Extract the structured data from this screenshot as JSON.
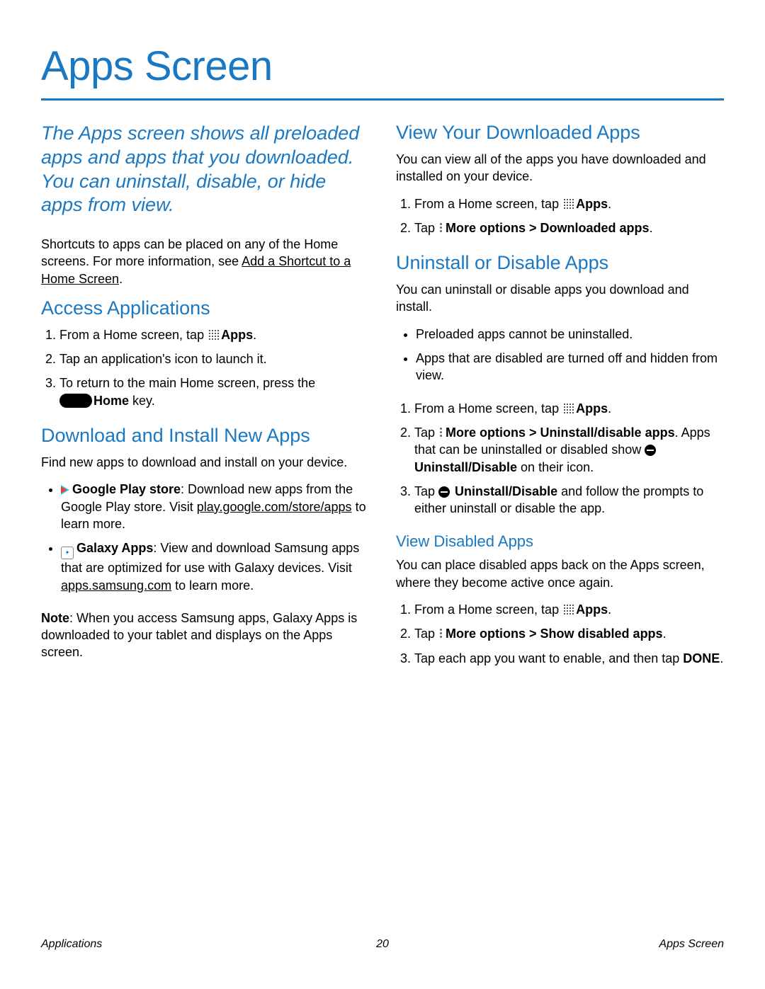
{
  "title": "Apps Screen",
  "intro": "The Apps screen shows all preloaded apps and apps that you downloaded. You can uninstall, disable, or hide apps from view.",
  "shortcuts_p1": "Shortcuts to apps can be placed on any of the Home screens. For more information, see ",
  "shortcuts_link": "Add a Shortcut to a Home Screen",
  "shortcuts_p2": ".",
  "access": {
    "heading": "Access Applications",
    "step1a": "From a Home screen, tap ",
    "step1b": "Apps",
    "step1c": ".",
    "step2": "Tap an application's icon to launch it.",
    "step3a": "To return to the main Home screen, press the ",
    "step3b": "Home",
    "step3c": " key."
  },
  "download": {
    "heading": "Download and Install New Apps",
    "intro": "Find new apps to download and install on your device.",
    "play_b": "Google Play store",
    "play_txt": ": Download new apps from the Google Play store. Visit ",
    "play_link": "play.google.com/store/apps",
    "play_end": " to learn more.",
    "galaxy_b": "Galaxy Apps",
    "galaxy_txt": ": View and download Samsung apps that are optimized for use with Galaxy devices. Visit ",
    "galaxy_link": "apps.samsung.com",
    "galaxy_end": " to learn more.",
    "note_b": "Note",
    "note_txt": ": When you access Samsung apps, Galaxy Apps is downloaded to your tablet and displays on the Apps screen."
  },
  "view_dl": {
    "heading": "View Your Downloaded Apps",
    "intro": "You can view all of the apps you have downloaded and installed on your device.",
    "step1a": "From a Home screen, tap ",
    "step1b": "Apps",
    "step1c": ".",
    "step2a": "Tap ",
    "step2b": "More options > Downloaded apps",
    "step2c": "."
  },
  "uninstall": {
    "heading": "Uninstall or Disable Apps",
    "intro": "You can uninstall or disable apps you download and install.",
    "bul1": "Preloaded apps cannot be uninstalled.",
    "bul2": "Apps that are disabled are turned off and hidden from view.",
    "step1a": "From a Home screen, tap ",
    "step1b": "Apps",
    "step1c": ".",
    "step2a": "Tap ",
    "step2b": "More options > Uninstall/disable apps",
    "step2c": ". Apps that can be uninstalled or disabled show ",
    "step2d": "Uninstall/Disable",
    "step2e": " on their icon.",
    "step3a": "Tap ",
    "step3b": "Uninstall/Disable",
    "step3c": " and follow the prompts to either uninstall or disable the app."
  },
  "view_disabled": {
    "heading": "View Disabled Apps",
    "intro": "You can place disabled apps back on the Apps screen, where they become active once again.",
    "step1a": "From a Home screen, tap ",
    "step1b": "Apps",
    "step1c": ".",
    "step2a": "Tap ",
    "step2b": "More options > Show disabled apps",
    "step2c": ".",
    "step3a": "Tap each app you want to enable, and then tap ",
    "step3b": "DONE",
    "step3c": "."
  },
  "footer": {
    "left": "Applications",
    "center": "20",
    "right": "Apps Screen"
  }
}
